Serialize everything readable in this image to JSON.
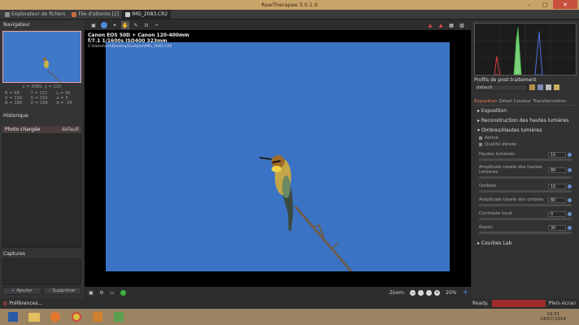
{
  "window": {
    "title": "RawTherapee 3.0.1.0"
  },
  "tabs": [
    {
      "label": "Explorateur de fichers"
    },
    {
      "label": "File d'attente",
      "count": "[2]"
    },
    {
      "label": "IMG_2083.CR2"
    }
  ],
  "navigator": {
    "title": "Navigateur",
    "coords": "x = 3080, y = 120",
    "values": [
      [
        "R = 68",
        "T = 152",
        "L = 45"
      ],
      [
        "V = 109",
        "S = 150",
        "a = 3"
      ],
      [
        "B = 186",
        "V = 186",
        "b = -34"
      ]
    ]
  },
  "history": {
    "title": "Historique",
    "row_label": "Photo chargée",
    "row_value": "default"
  },
  "captures": {
    "title": "Captures"
  },
  "left_buttons": {
    "add": "Ajouter",
    "remove": "Supprimer"
  },
  "exif": {
    "line1": "Canon EOS 50D + Canon 120-400mm",
    "line2": "f/7.1  1/1600s  ISO400  323mm",
    "path": "C:\\Users\\ero\\Desktop\\Guêpier\\IMG_2083.CR2"
  },
  "zoom": {
    "label": "Zoom:",
    "value": "20%"
  },
  "processing": {
    "title": "Profils de post-traitement",
    "profile": "default",
    "tabs": [
      "Exposition",
      "Détail",
      "Couleur",
      "Transformation"
    ]
  },
  "panel": {
    "exposure": "Exposition",
    "highlight_reconstruction": "Reconstruction des hautes lumières",
    "shadows_highlights": "Ombres/Hautes lumières",
    "active": "Activé",
    "high_quality": "Qualité élevée",
    "sliders": [
      {
        "label": "Hautes lumières",
        "value": "10"
      },
      {
        "label": "Amplitude tonale des hautes lumières",
        "value": "80"
      },
      {
        "label": "Ombres",
        "value": "10"
      },
      {
        "label": "Amplitude tonale des ombres",
        "value": "80"
      },
      {
        "label": "Contraste local",
        "value": "0"
      },
      {
        "label": "Rayon",
        "value": "30"
      }
    ],
    "tone_curve": "Courbes Lab"
  },
  "status": {
    "preferences": "Préférences...",
    "ready": "Ready.",
    "fullscreen": "Plein écran"
  },
  "clock": {
    "time": "19:31",
    "date": "24/07/2014"
  },
  "colors": {
    "sky": "#3b73c4",
    "accent": "#c7503d"
  }
}
